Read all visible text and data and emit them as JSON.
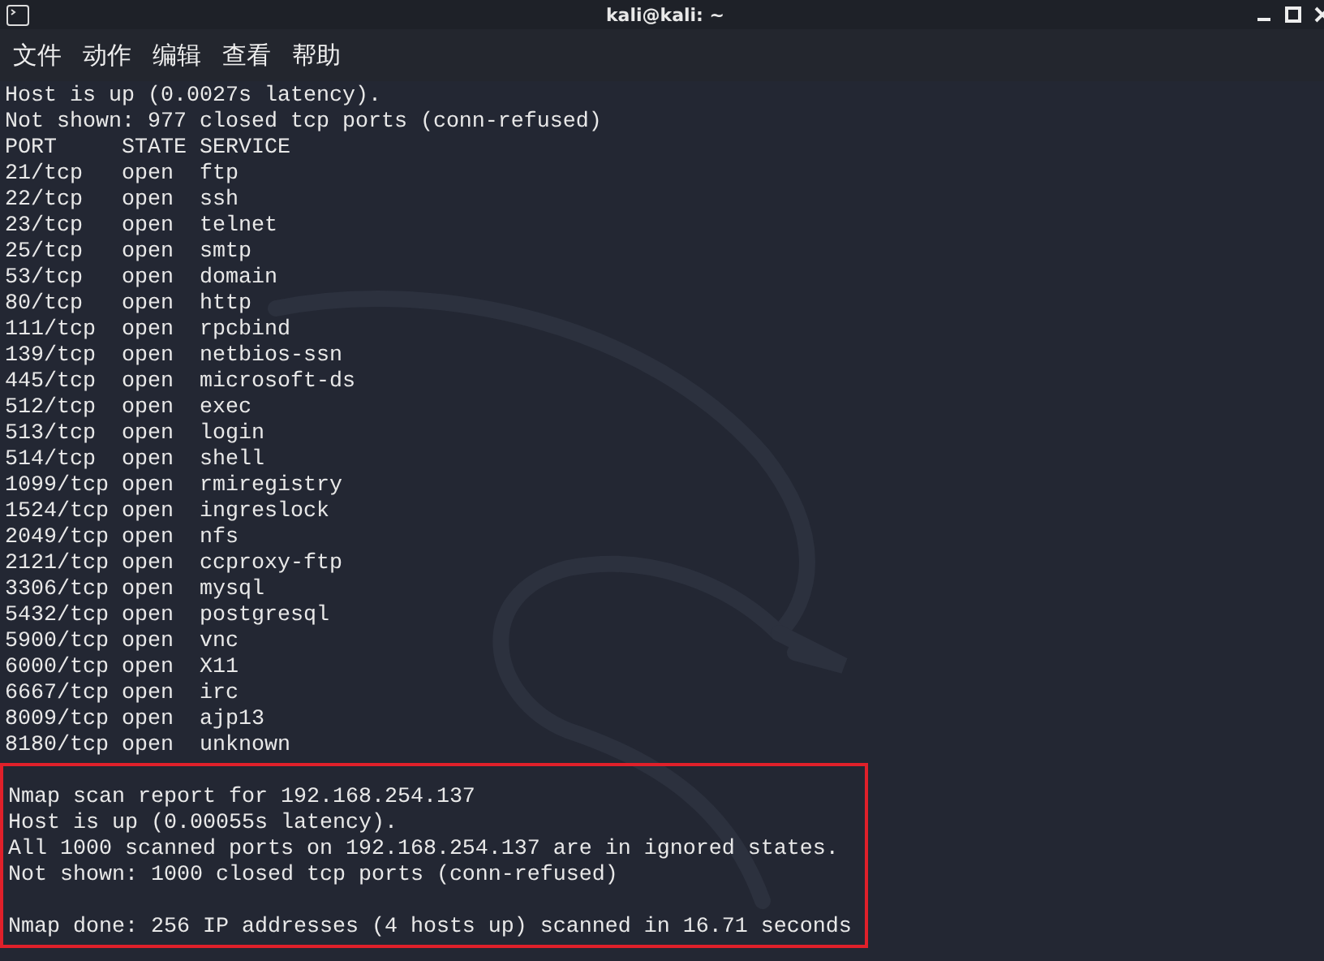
{
  "window": {
    "title": "kali@kali: ~"
  },
  "menu": [
    {
      "label": "文件"
    },
    {
      "label": "动作"
    },
    {
      "label": "编辑"
    },
    {
      "label": "查看"
    },
    {
      "label": "帮助"
    }
  ],
  "terminal": {
    "lines_before": [
      "Host is up (0.0027s latency).",
      "Not shown: 977 closed tcp ports (conn-refused)"
    ],
    "port_table": {
      "columns": [
        "PORT",
        "STATE",
        "SERVICE"
      ],
      "rows": [
        [
          "21/tcp",
          "open",
          "ftp"
        ],
        [
          "22/tcp",
          "open",
          "ssh"
        ],
        [
          "23/tcp",
          "open",
          "telnet"
        ],
        [
          "25/tcp",
          "open",
          "smtp"
        ],
        [
          "53/tcp",
          "open",
          "domain"
        ],
        [
          "80/tcp",
          "open",
          "http"
        ],
        [
          "111/tcp",
          "open",
          "rpcbind"
        ],
        [
          "139/tcp",
          "open",
          "netbios-ssn"
        ],
        [
          "445/tcp",
          "open",
          "microsoft-ds"
        ],
        [
          "512/tcp",
          "open",
          "exec"
        ],
        [
          "513/tcp",
          "open",
          "login"
        ],
        [
          "514/tcp",
          "open",
          "shell"
        ],
        [
          "1099/tcp",
          "open",
          "rmiregistry"
        ],
        [
          "1524/tcp",
          "open",
          "ingreslock"
        ],
        [
          "2049/tcp",
          "open",
          "nfs"
        ],
        [
          "2121/tcp",
          "open",
          "ccproxy-ftp"
        ],
        [
          "3306/tcp",
          "open",
          "mysql"
        ],
        [
          "5432/tcp",
          "open",
          "postgresql"
        ],
        [
          "5900/tcp",
          "open",
          "vnc"
        ],
        [
          "6000/tcp",
          "open",
          "X11"
        ],
        [
          "6667/tcp",
          "open",
          "irc"
        ],
        [
          "8009/tcp",
          "open",
          "ajp13"
        ],
        [
          "8180/tcp",
          "open",
          "unknown"
        ]
      ]
    },
    "highlighted_block": {
      "groups": [
        {
          "lines": [
            "Nmap scan report for 192.168.254.137",
            "Host is up (0.00055s latency).",
            "All 1000 scanned ports on 192.168.254.137 are in ignored states.",
            "Not shown: 1000 closed tcp ports (conn-refused)"
          ]
        },
        {
          "lines": [
            "Nmap done: 256 IP addresses (4 hosts up) scanned in 16.71 seconds"
          ]
        }
      ]
    }
  }
}
